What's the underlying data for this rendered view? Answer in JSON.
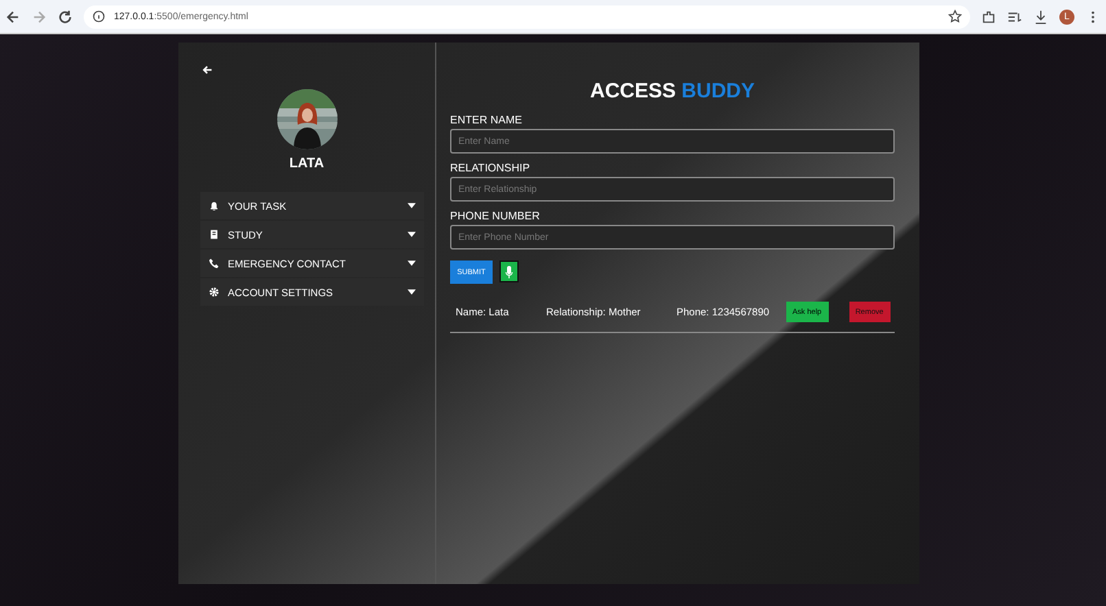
{
  "browser": {
    "url_host": "127.0.0.1",
    "url_rest": ":5500/emergency.html",
    "profile_initial": "L"
  },
  "profile": {
    "name": "LATA"
  },
  "menu": [
    {
      "label": "YOUR TASK"
    },
    {
      "label": "STUDY"
    },
    {
      "label": "EMERGENCY CONTACT"
    },
    {
      "label": "ACCOUNT SETTINGS"
    }
  ],
  "title": "ACCESS",
  "title_accent": "BUDDY",
  "fields": [
    {
      "label": "ENTER NAME",
      "placeholder": "Enter Name"
    },
    {
      "label": "RELATIONSHIP",
      "placeholder": "Enter Relationship"
    },
    {
      "label": "PHONE NUMBER",
      "placeholder": "Enter Phone Number"
    }
  ],
  "submit": "SUBMIT",
  "contacts": [
    {
      "name": "Name: Lata",
      "relationship": "Relationship: Mother",
      "phone": "Phone: 1234567890",
      "help": "Ask help",
      "remove": "Remove"
    }
  ]
}
